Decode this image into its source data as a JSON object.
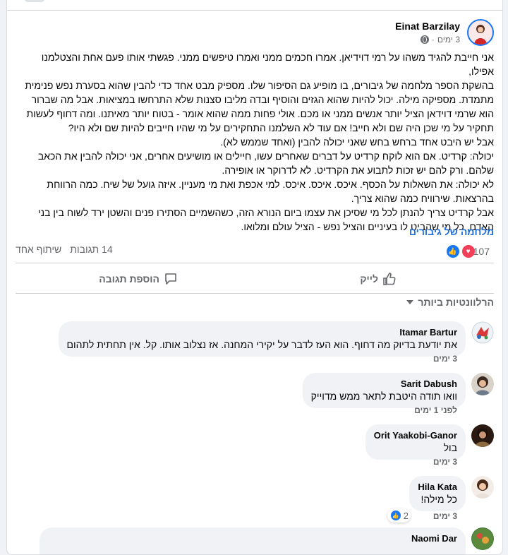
{
  "post": {
    "author": "Einat Barzilay",
    "time": "3 ימים",
    "body": "אני חייבת להגיד משהו על רמי דוידיאן. אמרו חכמים ממני ואמרו טיפשים ממני. פגשתי אותו פעם אחת והצטלמנו אפילו,\nבהשקת הספר מלחמה של גיבורים, בו מופיע גם הסיפור שלו. מספיק מבט אחד כדי להבין שהוא בסערת נפש פנימית\nמתמדת. מספיקה מילה. יכול להיות שהוא הגזים והוסיף ובדה מליבו סצנות שלא התרחשו במציאות. אבל מה שברור\nהוא שרמי דוידאן הציל יותר אנשים ממני או מכם. אולי פחות ממה שהוא אומר - בטוח יותר מאיתנו. ומה דחוף לעשות\nתחקיר על מי שכן היה שם ולא חייב! אם עוד לא השלמנו התחקירים על מי שהיו חייבים להיות שם ולא היו?\nאבל יש היבט אחד ברחש בחש שאני יכולה להבין (ואחד שממש לא).\nיכולה: קרדיט. אם הוא לוקח קרדיט על דברים שאחרים עשו, חיילים או מושיעים אחרים, אני יכולה להבין את הכאב\nשלהם. ורק להם יש זכות לתבוע את הקרדיט. לא לדרוקר או אופירה.\nלא יכולה: את השאלות על הכסף. איכס. איכס. איכס. למי אכפת ואת מי מעניין. איזה גועל של שיח. כמה הרווחת\nבהרצאות. שירוויח כמה שהוא צריך.\nאבל קרדיט צריך להנתן לכל מי שסיכן את עצמו ביום הנורא הזה, כשהשמיים הסתירו פנים והשטן ירד לשוח בין בני\nהאדם, כל מי שהביט לו בעיניים והציל נפש - הציל עולם ומלואו.",
    "link": "מלחמה של גיבורים"
  },
  "stats": {
    "reactions": "107",
    "comments": "14 תגובות",
    "shares": "שיתוף אחד"
  },
  "actions": {
    "like": "לייק",
    "comment": "הוספת תגובה"
  },
  "filter": "הרלוונטיות ביותר",
  "comments": [
    {
      "name": "Itamar Bartur",
      "text": "את יודעת בדיוק מה דחוף. הוא העז לדבר על יקירי המחנה. אז נצלוב אותו. קל. אין תחתית לתהום",
      "time": "3 ימים"
    },
    {
      "name": "Sarit Dabush",
      "text": "וואו תודה היטבת לתאר ממש מדוייק",
      "time": "לפני 1 ימים"
    },
    {
      "name": "Orit Yaakobi-Ganor",
      "text": "בול",
      "time": "3 ימים"
    },
    {
      "name": "Hila Kata",
      "text": "כל מילה!",
      "time": "3 ימים",
      "likes": "2"
    },
    {
      "name": "Naomi Dar",
      "text": "",
      "time": ""
    }
  ],
  "colors": {
    "link": "#216fdb",
    "like": "#1877f2",
    "love": "#f33e58",
    "meta": "#65676b"
  }
}
